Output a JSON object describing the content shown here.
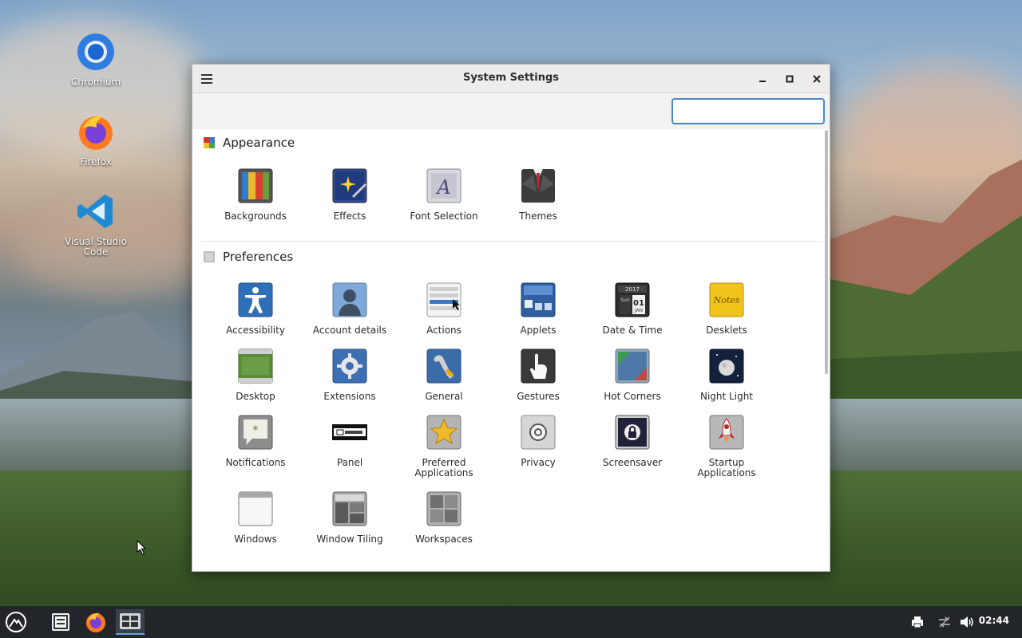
{
  "desktop": {
    "icons": [
      {
        "label": "Chromium",
        "icon": "chromium-icon"
      },
      {
        "label": "Firefox",
        "icon": "firefox-icon"
      },
      {
        "label": "Visual Studio Code",
        "icon": "vscode-icon"
      }
    ]
  },
  "window": {
    "title": "System Settings",
    "search": {
      "value": "",
      "placeholder": ""
    },
    "sections": [
      {
        "title": "Appearance",
        "items": [
          {
            "label": "Backgrounds",
            "icon": "backgrounds-icon"
          },
          {
            "label": "Effects",
            "icon": "effects-icon"
          },
          {
            "label": "Font Selection",
            "icon": "font-selection-icon"
          },
          {
            "label": "Themes",
            "icon": "themes-icon"
          }
        ]
      },
      {
        "title": "Preferences",
        "items": [
          {
            "label": "Accessibility",
            "icon": "accessibility-icon"
          },
          {
            "label": "Account details",
            "icon": "account-details-icon"
          },
          {
            "label": "Actions",
            "icon": "actions-icon"
          },
          {
            "label": "Applets",
            "icon": "applets-icon"
          },
          {
            "label": "Date & Time",
            "icon": "date-time-icon"
          },
          {
            "label": "Desklets",
            "icon": "desklets-icon"
          },
          {
            "label": "Desktop",
            "icon": "desktop-icon"
          },
          {
            "label": "Extensions",
            "icon": "extensions-icon"
          },
          {
            "label": "General",
            "icon": "general-icon"
          },
          {
            "label": "Gestures",
            "icon": "gestures-icon"
          },
          {
            "label": "Hot Corners",
            "icon": "hot-corners-icon"
          },
          {
            "label": "Night Light",
            "icon": "night-light-icon"
          },
          {
            "label": "Notifications",
            "icon": "notifications-icon"
          },
          {
            "label": "Panel",
            "icon": "panel-icon"
          },
          {
            "label": "Preferred Applications",
            "icon": "preferred-applications-icon"
          },
          {
            "label": "Privacy",
            "icon": "privacy-icon"
          },
          {
            "label": "Screensaver",
            "icon": "screensaver-icon"
          },
          {
            "label": "Startup Applications",
            "icon": "startup-applications-icon"
          },
          {
            "label": "Windows",
            "icon": "windows-icon"
          },
          {
            "label": "Window Tiling",
            "icon": "window-tiling-icon"
          },
          {
            "label": "Workspaces",
            "icon": "workspaces-icon"
          }
        ]
      }
    ]
  },
  "date_time_icon_text": {
    "year": "2017",
    "month": "JAN",
    "day": "01",
    "weekday": "Sun"
  },
  "desklets_icon_text": "Notes",
  "taskbar": {
    "clock": "02:44",
    "apps": [
      "menu-icon",
      "file-manager-icon",
      "firefox-icon",
      "system-settings-icon"
    ],
    "tray": [
      "printer-icon",
      "network-icon",
      "volume-icon"
    ]
  },
  "colors": {
    "accent": "#4a86c8",
    "taskbar": "#22262a",
    "titlebar": "#eeedeb"
  }
}
